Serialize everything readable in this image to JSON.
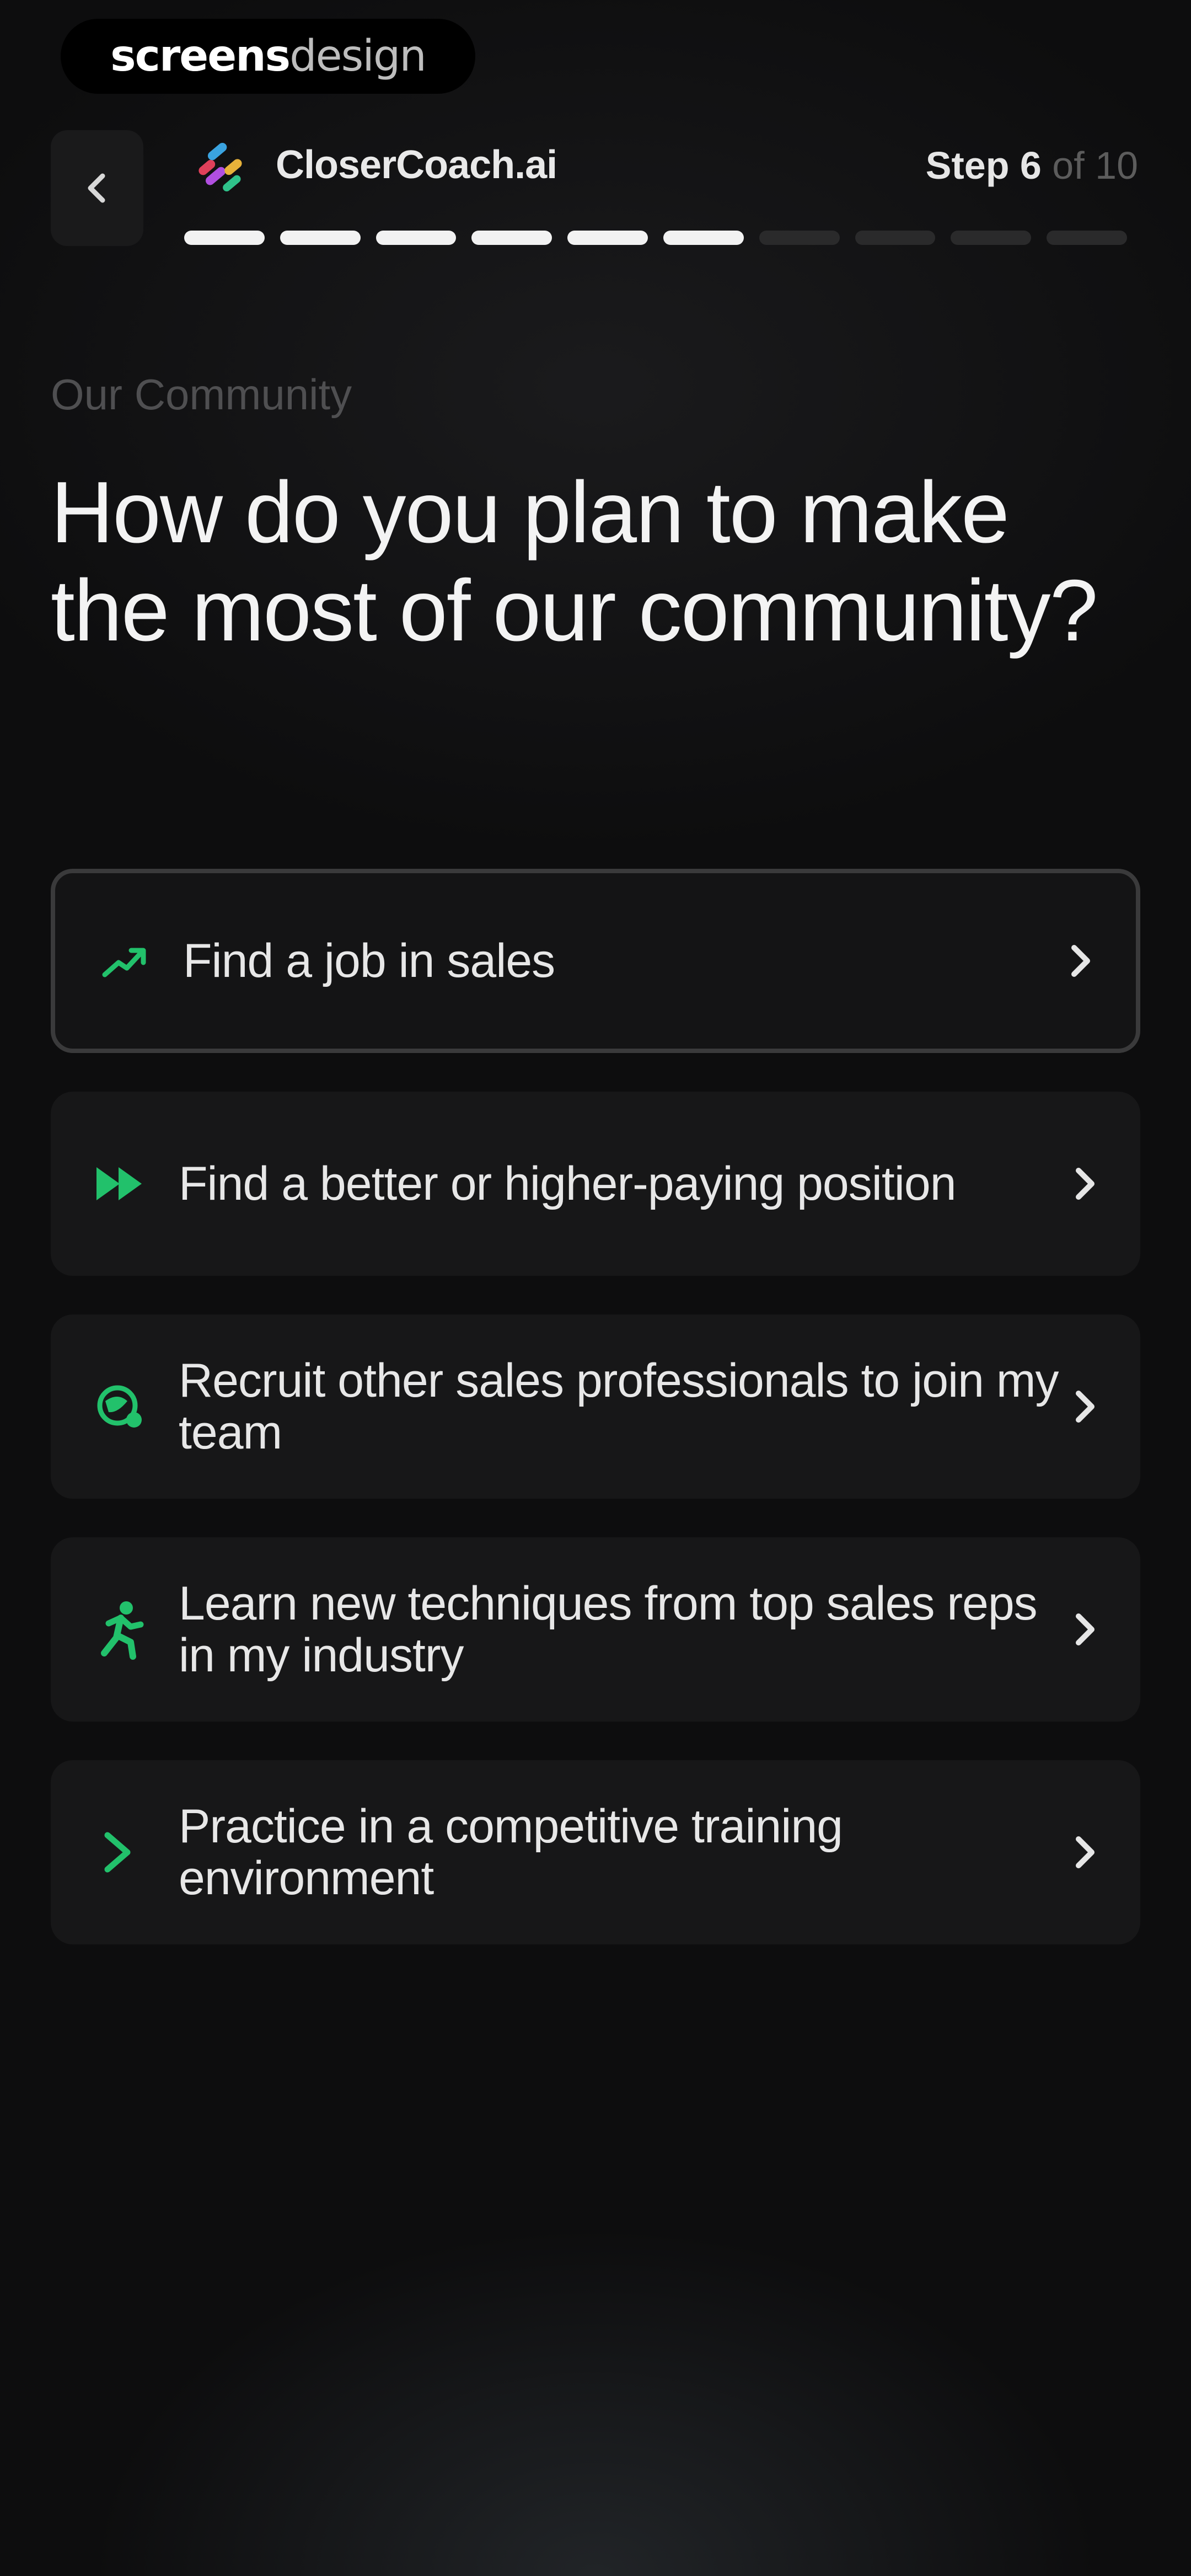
{
  "watermark": {
    "bold": "screens",
    "light": "design"
  },
  "header": {
    "brand": "CloserCoach.ai",
    "step_current": "Step 6",
    "step_total": " of 10",
    "progress": {
      "completed": 6,
      "total": 10
    }
  },
  "page": {
    "eyebrow": "Our Community",
    "title": "How do you plan to make the most of our community?"
  },
  "options": [
    {
      "label": "Find a job in sales",
      "icon": "trend-up-icon",
      "selected": true
    },
    {
      "label": "Find a better or higher-paying position",
      "icon": "fast-forward-icon",
      "selected": false
    },
    {
      "label": "Recruit other sales professionals to join my team",
      "icon": "recruit-globe-icon",
      "selected": false
    },
    {
      "label": "Learn new techniques from top sales reps in my industry",
      "icon": "running-person-icon",
      "selected": false
    },
    {
      "label": "Practice in a competitive training environment",
      "icon": "chevron-right-icon",
      "selected": false
    }
  ],
  "colors": {
    "background": "#0d0d0e",
    "card": "#171718",
    "accent_green": "#22c16b",
    "text": "#e7e7e7",
    "muted": "#4f4f51"
  }
}
